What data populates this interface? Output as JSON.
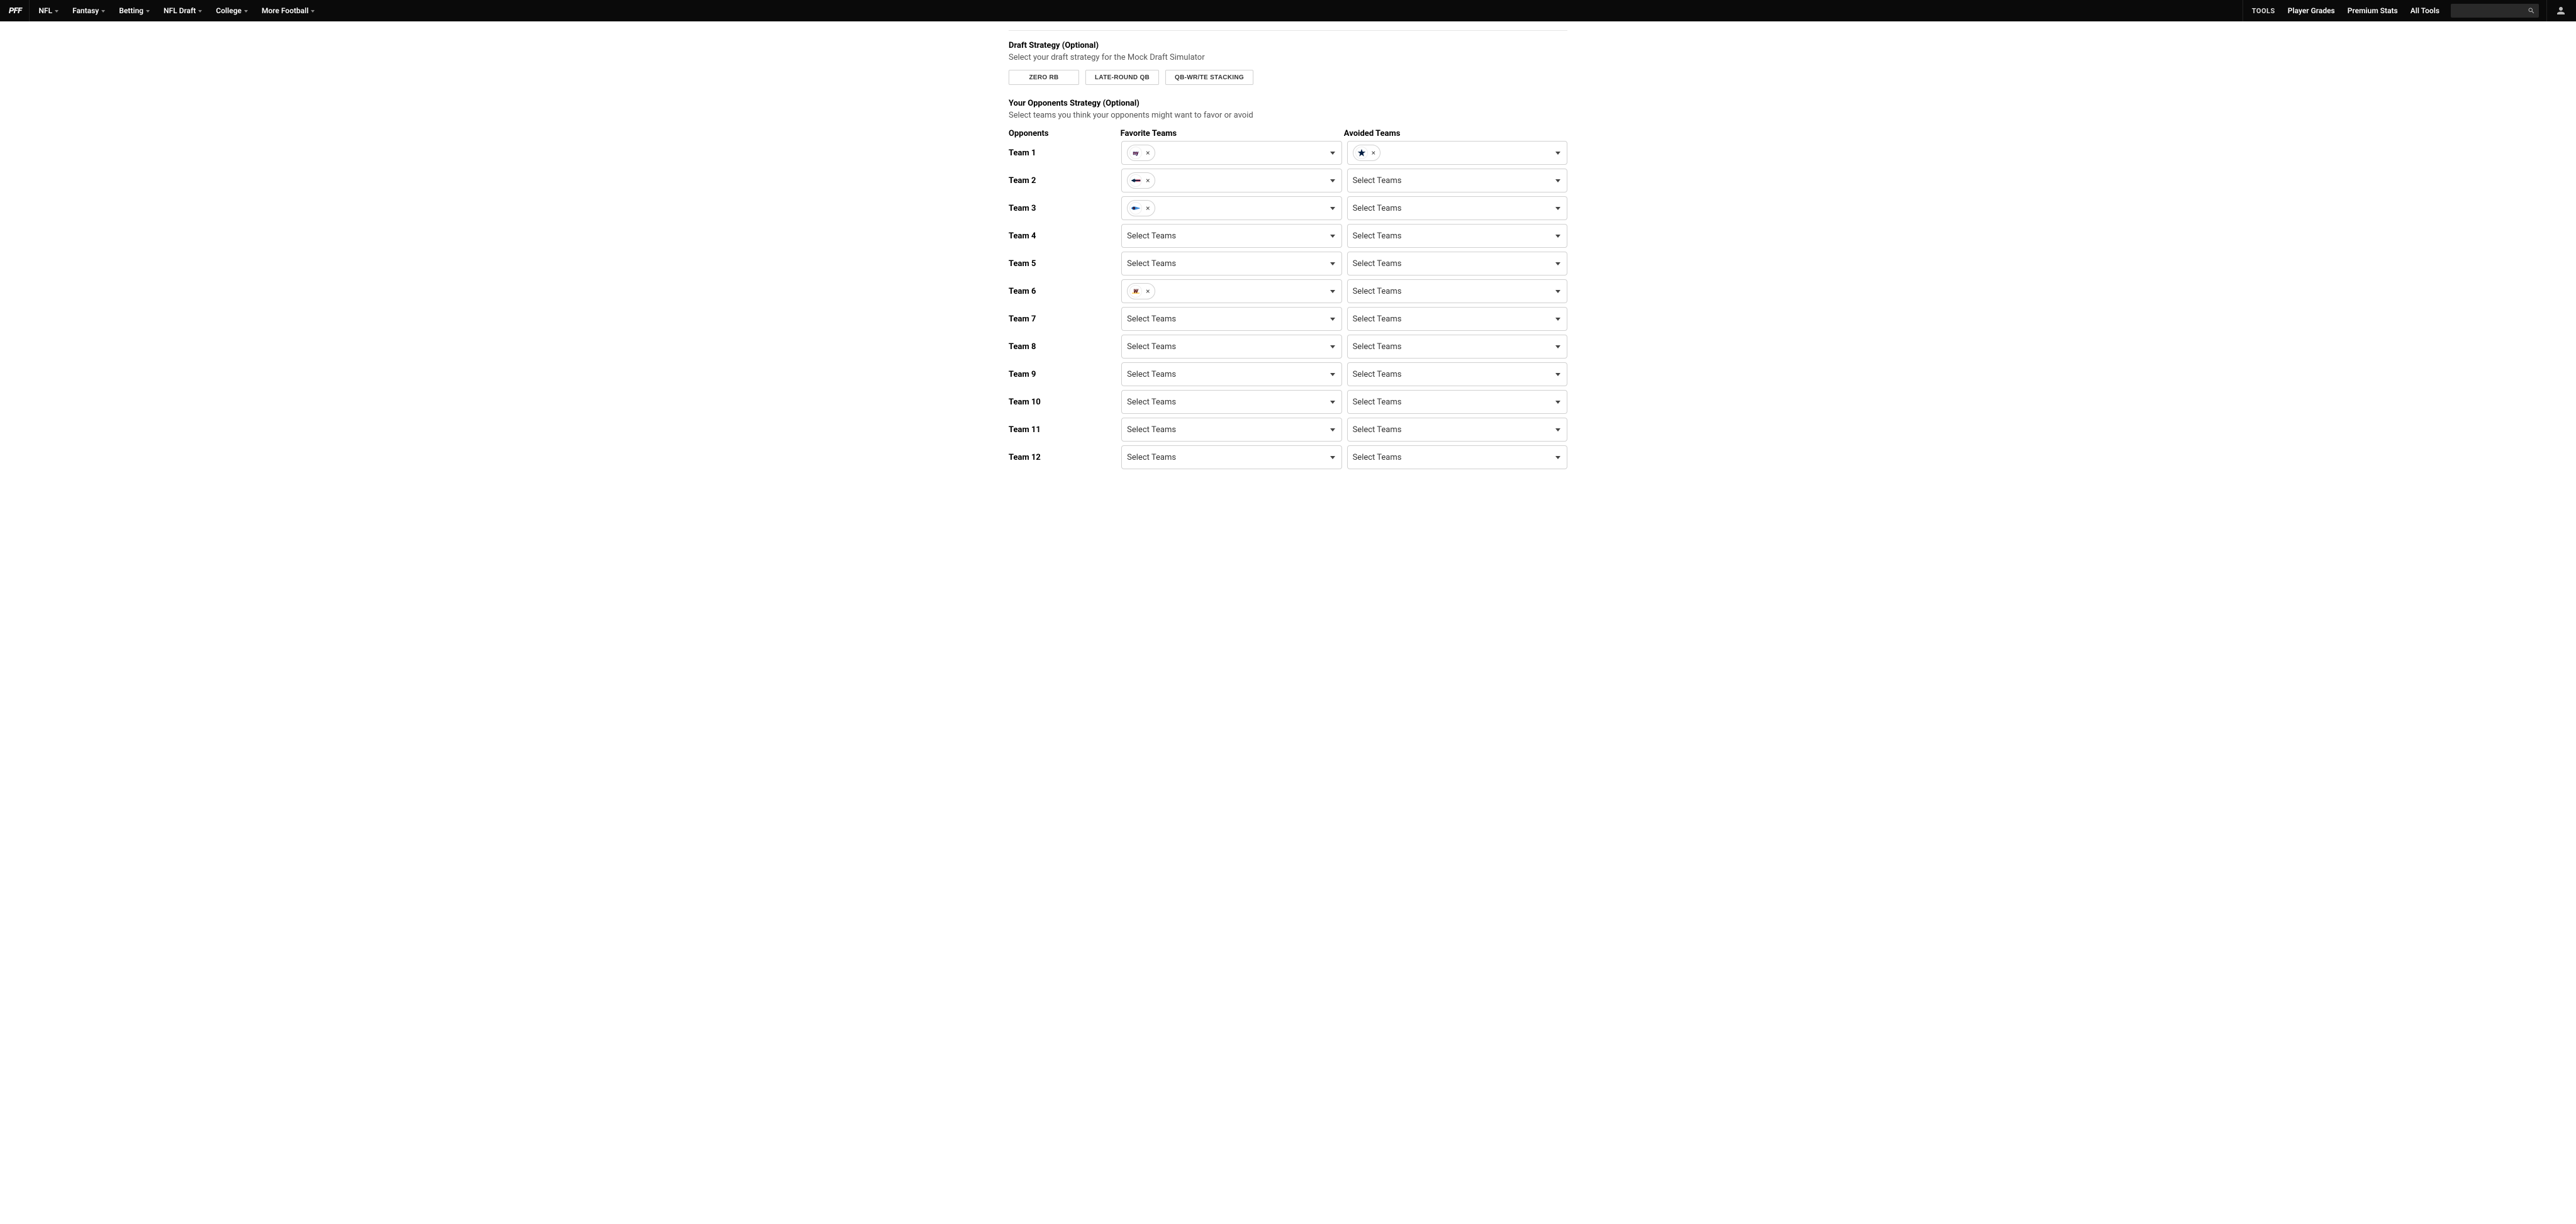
{
  "topbar": {
    "logo": "PFF",
    "nav": [
      "NFL",
      "Fantasy",
      "Betting",
      "NFL Draft",
      "College",
      "More Football"
    ],
    "tools_label": "TOOLS",
    "right_links": [
      "Player Grades",
      "Premium Stats",
      "All Tools"
    ]
  },
  "draft_strategy": {
    "title": "Draft Strategy (Optional)",
    "subtitle": "Select your draft strategy for the Mock Draft Simulator",
    "options": [
      "ZERO RB",
      "LATE-ROUND QB",
      "QB-WR/TE STACKING"
    ]
  },
  "opponents_strategy": {
    "title": "Your Opponents Strategy (Optional)",
    "subtitle": "Select teams you think your opponents might want to favor or avoid",
    "col_opponents": "Opponents",
    "col_favorite": "Favorite Teams",
    "col_avoided": "Avoided Teams",
    "select_placeholder": "Select Teams",
    "rows": [
      {
        "name": "Team 1",
        "favorite": [
          "nyg"
        ],
        "avoided": [
          "dal"
        ]
      },
      {
        "name": "Team 2",
        "favorite": [
          "ne"
        ],
        "avoided": []
      },
      {
        "name": "Team 3",
        "favorite": [
          "ten"
        ],
        "avoided": []
      },
      {
        "name": "Team 4",
        "favorite": [],
        "avoided": []
      },
      {
        "name": "Team 5",
        "favorite": [],
        "avoided": []
      },
      {
        "name": "Team 6",
        "favorite": [
          "was"
        ],
        "avoided": []
      },
      {
        "name": "Team 7",
        "favorite": [],
        "avoided": []
      },
      {
        "name": "Team 8",
        "favorite": [],
        "avoided": []
      },
      {
        "name": "Team 9",
        "favorite": [],
        "avoided": []
      },
      {
        "name": "Team 10",
        "favorite": [],
        "avoided": []
      },
      {
        "name": "Team 11",
        "favorite": [],
        "avoided": []
      },
      {
        "name": "Team 12",
        "favorite": [],
        "avoided": []
      }
    ]
  },
  "teams": {
    "nyg": {
      "name": "New York Giants"
    },
    "dal": {
      "name": "Dallas Cowboys"
    },
    "ne": {
      "name": "New England Patriots"
    },
    "ten": {
      "name": "Tennessee Titans"
    },
    "was": {
      "name": "Washington Commanders"
    }
  }
}
